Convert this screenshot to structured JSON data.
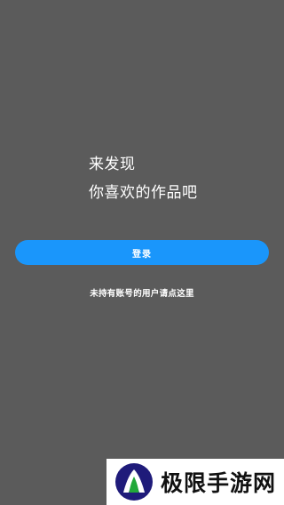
{
  "headline": {
    "line1": "来发现",
    "line2": "你喜欢的作品吧"
  },
  "login": {
    "label": "登录"
  },
  "register_link": {
    "text": "未持有账号的用户请点这里"
  },
  "watermark": {
    "text": "极限手游网"
  },
  "colors": {
    "background": "#5b5b5b",
    "accent": "#1a96fb",
    "text": "#ffffff"
  }
}
